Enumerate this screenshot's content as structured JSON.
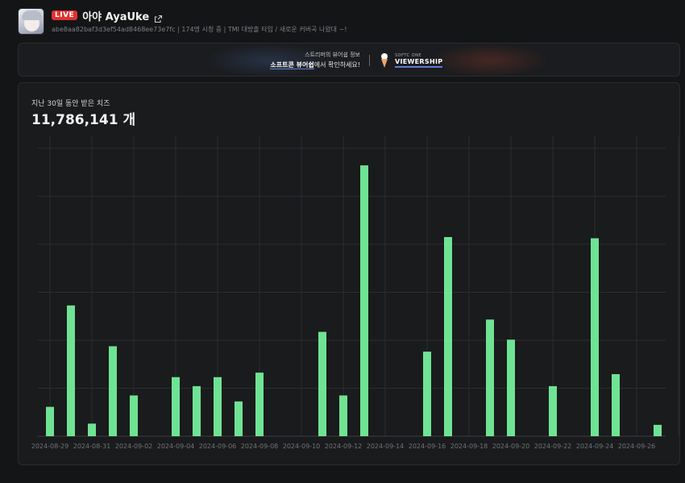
{
  "channel": {
    "live_badge": "LIVE",
    "name": "아야 AyaUke",
    "subtitle": "abe8aa82baf3d3ef54ad8468ee73e7fc | 174명 시청 중 | TMI 대방출 타임 / 새로운 커버곡 나왔대 ~!"
  },
  "banner": {
    "line1": "스트리머의 뷰어쉽 정보",
    "line2_bold": "소프트콘 뷰어쉽",
    "line2_rest": "에서 확인하세요!",
    "brand_small": "SOFTC ONE",
    "brand_big": "VIEWERSHIP"
  },
  "summary": {
    "label": "지난 30일 동안 받은 치즈",
    "total_value": "11,786,141",
    "total_unit": "개"
  },
  "colors": {
    "bar": "#6fe394",
    "background": "#141517",
    "card": "#1a1b1d",
    "grid": "#2b2d31",
    "accent": "#e0322f"
  },
  "chart_data": {
    "type": "bar",
    "title": "지난 30일 동안 받은 치즈",
    "x": [
      "2024-08-29",
      "2024-08-30",
      "2024-08-31",
      "2024-09-01",
      "2024-09-02",
      "2024-09-03",
      "2024-09-04",
      "2024-09-05",
      "2024-09-06",
      "2024-09-07",
      "2024-09-08",
      "2024-09-09",
      "2024-09-10",
      "2024-09-11",
      "2024-09-12",
      "2024-09-13",
      "2024-09-14",
      "2024-09-15",
      "2024-09-16",
      "2024-09-17",
      "2024-09-18",
      "2024-09-19",
      "2024-09-20",
      "2024-09-21",
      "2024-09-22",
      "2024-09-23",
      "2024-09-24",
      "2024-09-25",
      "2024-09-26",
      "2024-09-27"
    ],
    "values": [
      98000,
      436000,
      42000,
      300000,
      136000,
      0,
      197000,
      167000,
      197000,
      116000,
      212000,
      0,
      0,
      348000,
      136000,
      903000,
      0,
      0,
      282000,
      664000,
      0,
      389000,
      322000,
      0,
      167000,
      0,
      660000,
      207000,
      0,
      38000
    ],
    "tick_labels": [
      "2024-08-29",
      "2024-08-31",
      "2024-09-02",
      "2024-09-04",
      "2024-09-06",
      "2024-09-08",
      "2024-09-10",
      "2024-09-12",
      "2024-09-14",
      "2024-09-16",
      "2024-09-18",
      "2024-09-20",
      "2024-09-22",
      "2024-09-24",
      "2024-09-26"
    ],
    "ylim": [
      0,
      1000000
    ],
    "grid": true
  }
}
